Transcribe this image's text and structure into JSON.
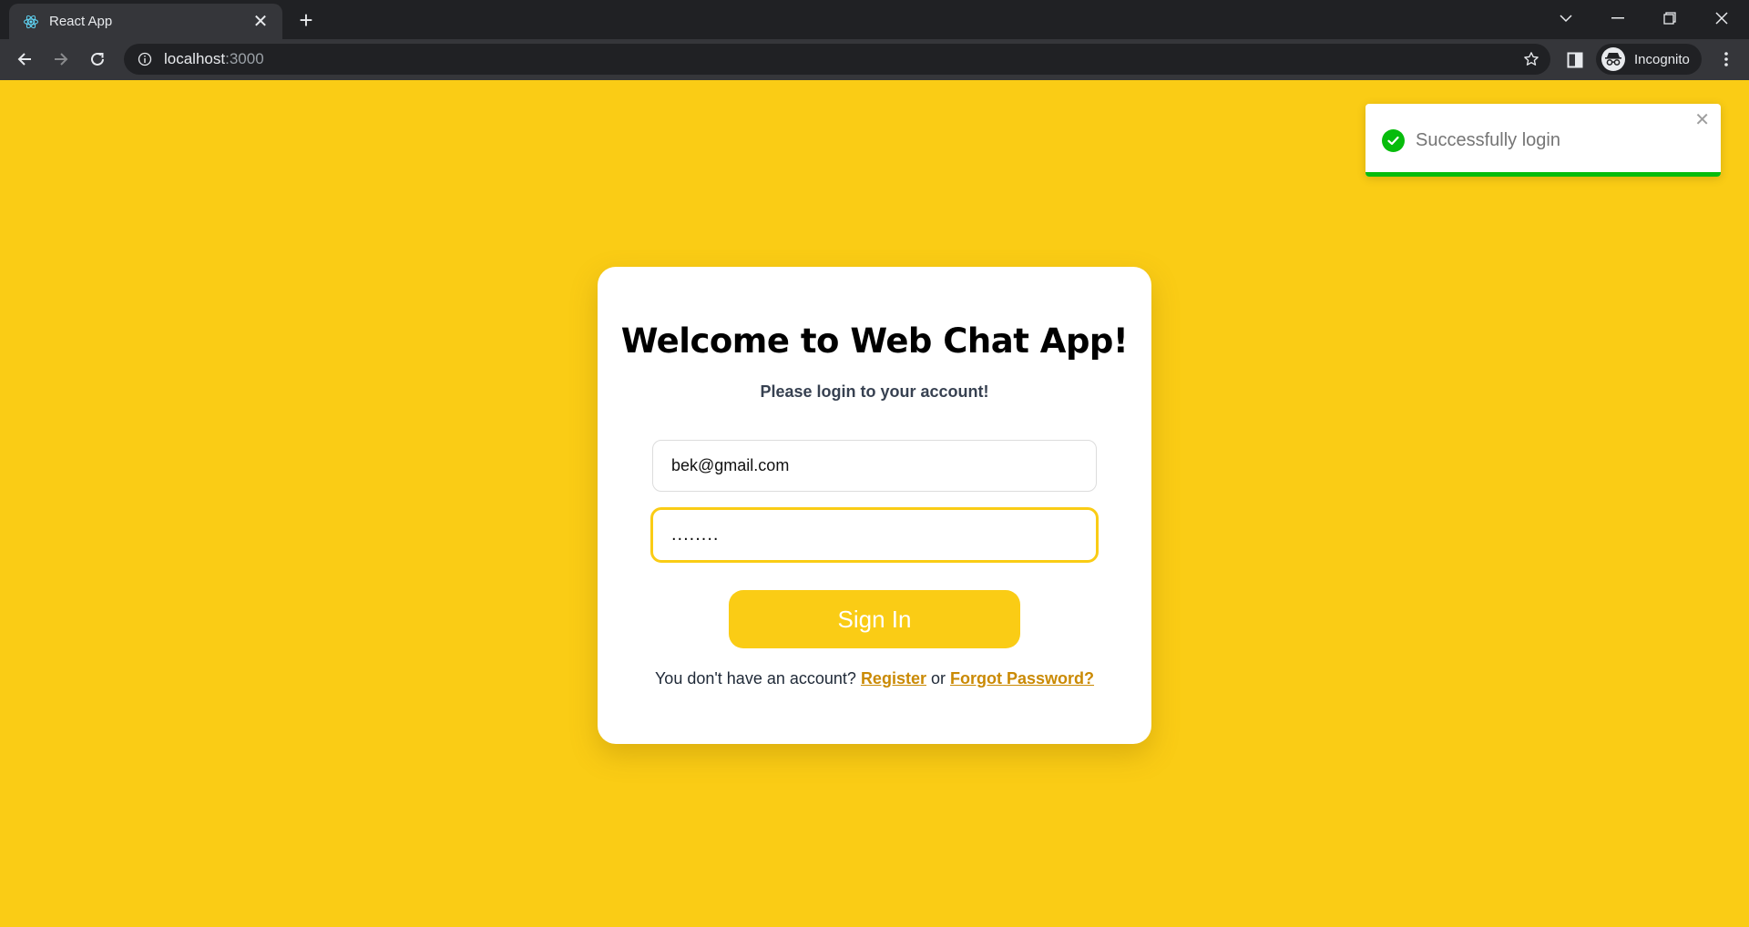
{
  "browser": {
    "tab_title": "React App",
    "url_host": "localhost",
    "url_port": ":3000",
    "profile_label": "Incognito"
  },
  "login": {
    "title": "Welcome to Web Chat App!",
    "subtitle": "Please login to your account!",
    "email_value": "bek@gmail.com",
    "password_value": "........",
    "signin_label": "Sign In",
    "footer_prefix": "You don't have an account?",
    "register_label": "Register",
    "or_text": "or",
    "forgot_label": "Forgot Password?"
  },
  "toast": {
    "message": "Successfully login",
    "progress": 1.0
  },
  "colors": {
    "background": "#facc15",
    "accent": "#facc15",
    "link": "#ca8a04",
    "success": "#07bc0c"
  }
}
